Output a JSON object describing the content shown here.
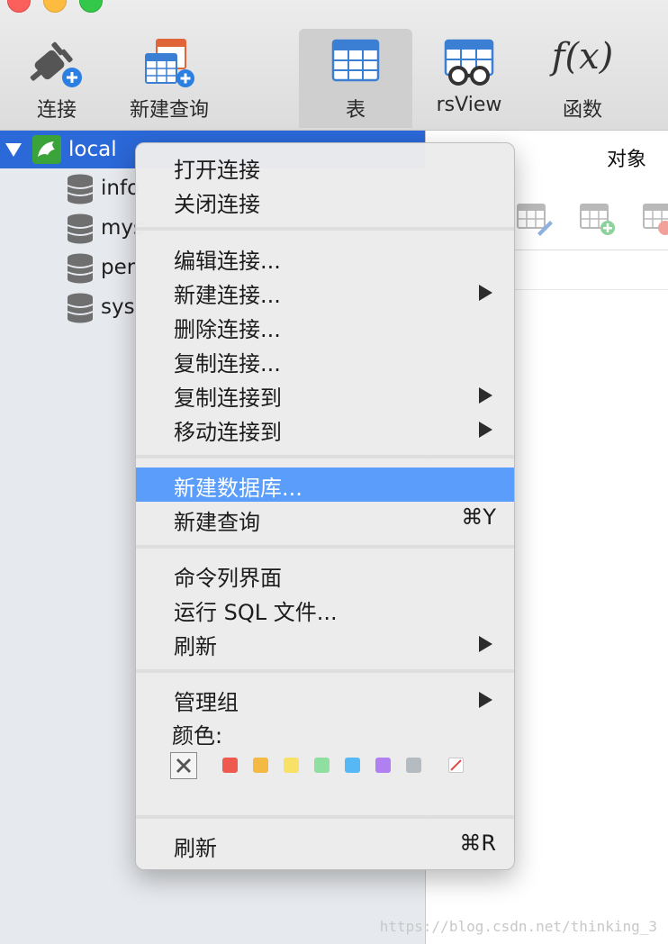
{
  "toolbar": {
    "buttons": [
      {
        "label": "连接",
        "icon": "connection-plug-icon"
      },
      {
        "label": "新建查询",
        "icon": "new-query-icon"
      },
      {
        "label": "表",
        "icon": "table-icon",
        "active": true
      },
      {
        "label": "rsView",
        "icon": "view-icon"
      },
      {
        "label": "函数",
        "icon": "function-icon",
        "glyph": "f(x)"
      }
    ]
  },
  "sidebar": {
    "connection": {
      "name": "local",
      "icon": "mysql-dolphin-icon"
    },
    "databases": [
      {
        "name": "info",
        "icon": "database-icon"
      },
      {
        "name": "mys",
        "icon": "database-icon"
      },
      {
        "name": "per",
        "icon": "database-icon"
      },
      {
        "name": "sys",
        "icon": "database-icon"
      }
    ]
  },
  "right_panel": {
    "tab_label": "对象"
  },
  "context_menu": {
    "items": [
      {
        "label": "打开连接"
      },
      {
        "label": "关闭连接"
      },
      {
        "label": "编辑连接..."
      },
      {
        "label": "新建连接...",
        "submenu": true
      },
      {
        "label": "删除连接..."
      },
      {
        "label": "复制连接..."
      },
      {
        "label": "复制连接到",
        "submenu": true
      },
      {
        "label": "移动连接到",
        "submenu": true
      },
      {
        "label": "新建数据库...",
        "highlighted": true
      },
      {
        "label": "新建查询",
        "shortcut": "⌘Y"
      },
      {
        "label": "命令列界面"
      },
      {
        "label": "运行 SQL 文件..."
      },
      {
        "label": "刷新",
        "submenu": true
      },
      {
        "label": "管理组",
        "submenu": true
      },
      {
        "label": "刷新",
        "shortcut": "⌘R"
      }
    ],
    "color_label": "颜色:",
    "colors": [
      "#ee5a50",
      "#f4b942",
      "#f7e167",
      "#8fe0a0",
      "#56b8f5",
      "#b07ff0",
      "#b4bcc2"
    ]
  },
  "watermark": "https://blog.csdn.net/thinking_3",
  "accent_colors": {
    "selection": "#2b68d8",
    "menu_highlight": "#5a9dfb"
  }
}
